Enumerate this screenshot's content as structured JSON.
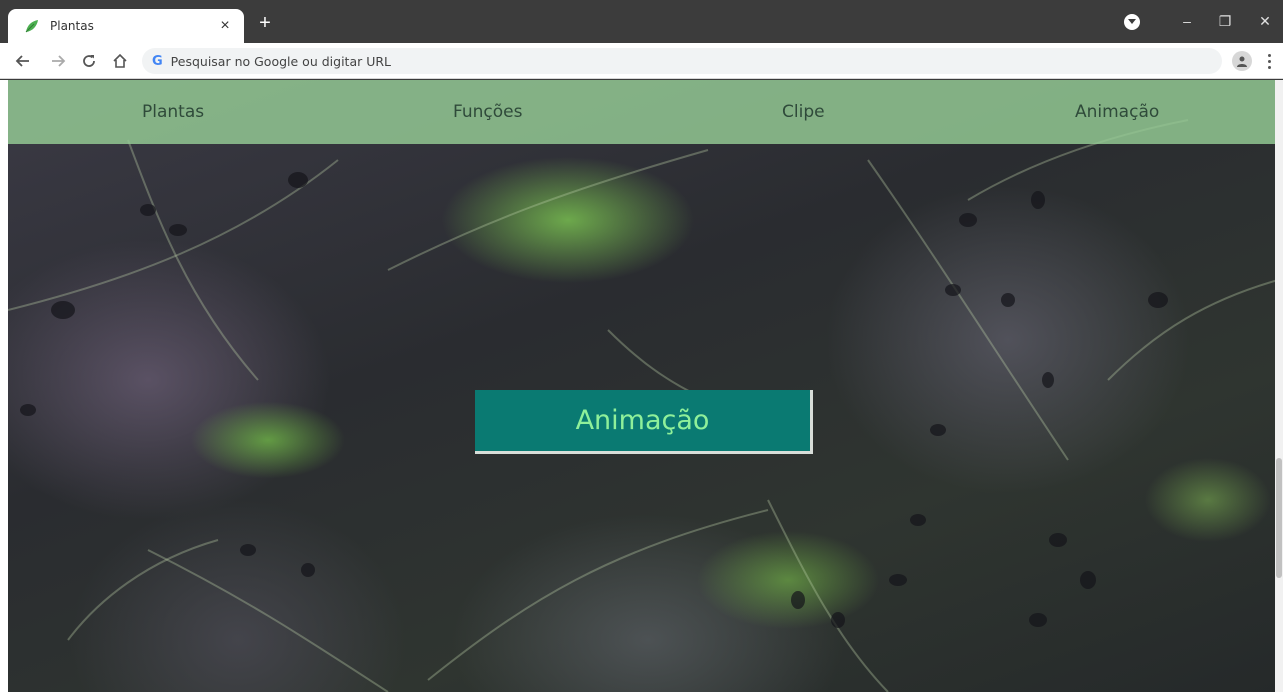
{
  "browser": {
    "tab_title": "Plantas",
    "tab_close": "×",
    "new_tab": "+",
    "omnibox_placeholder": "Pesquisar no Google ou digitar URL",
    "omnibox_google_letter": "G",
    "window_controls": {
      "minimize": "–",
      "restore": "❐",
      "close": "✕"
    }
  },
  "nav": {
    "items": [
      {
        "label": "Plantas"
      },
      {
        "label": "Funções"
      },
      {
        "label": "Clipe"
      },
      {
        "label": "Animação"
      }
    ]
  },
  "hero": {
    "button_label": "Animação"
  },
  "colors": {
    "nav_bg": "#96cd96",
    "hero_button_bg": "#0a7a72",
    "hero_button_text": "#8ff09a"
  },
  "icons": [
    "leaf-favicon-icon",
    "back-arrow-icon",
    "forward-arrow-icon",
    "reload-icon",
    "home-icon",
    "google-g-icon",
    "profile-icon",
    "menu-kebab-icon"
  ]
}
